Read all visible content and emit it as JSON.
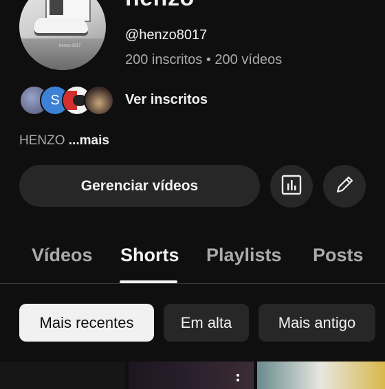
{
  "channel": {
    "name": "henzo",
    "handle": "@henzo8017",
    "subscribers": "200 inscritos",
    "separator": "•",
    "videos_count": "200 vídeos",
    "avatar_watermark": "henzo 8017"
  },
  "subscribers_preview": {
    "avatars": [
      "subscriber-avatar-1",
      "S",
      "subscriber-avatar-3",
      "subscriber-avatar-4"
    ],
    "label": "Ver inscritos"
  },
  "description": {
    "text": "HENZO",
    "more": "...mais"
  },
  "actions": {
    "manage_label": "Gerenciar vídeos",
    "stats_icon": "analytics-icon",
    "edit_icon": "pencil-icon"
  },
  "tabs": [
    {
      "label": "Vídeos",
      "active": false
    },
    {
      "label": "Shorts",
      "active": true
    },
    {
      "label": "Playlists",
      "active": false
    },
    {
      "label": "Posts",
      "active": false
    }
  ],
  "chips": [
    {
      "label": "Mais recentes",
      "active": true
    },
    {
      "label": "Em alta",
      "active": false
    },
    {
      "label": "Mais antigo",
      "active": false
    }
  ],
  "colors": {
    "background": "#0f0f0f",
    "surface": "#272727",
    "text": "#f1f1f1",
    "muted": "#aaaaaa"
  }
}
